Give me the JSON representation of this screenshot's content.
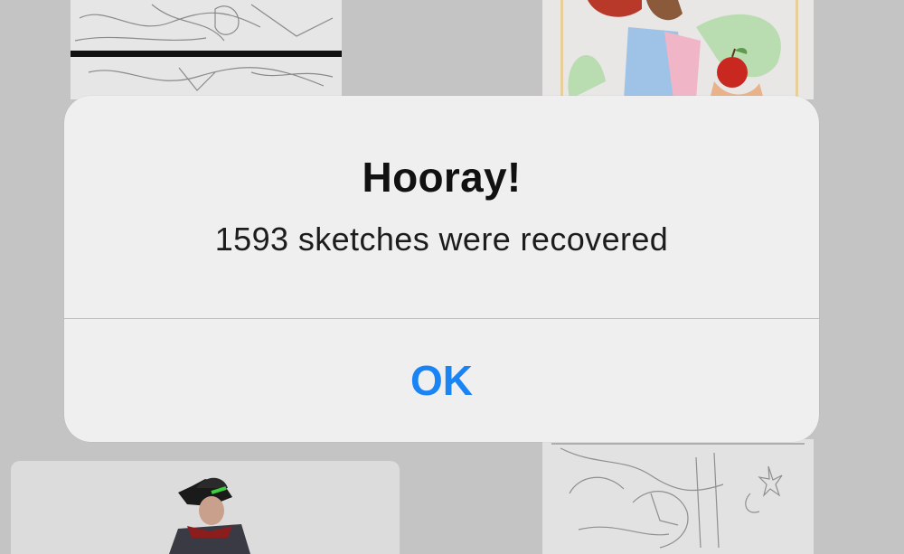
{
  "alert": {
    "title": "Hooray!",
    "message": "1593 sketches were recovered",
    "ok_label": "OK"
  },
  "colors": {
    "background": "#c4c4c4",
    "alert_background": "#efefef",
    "accent": "#1a84f4"
  }
}
